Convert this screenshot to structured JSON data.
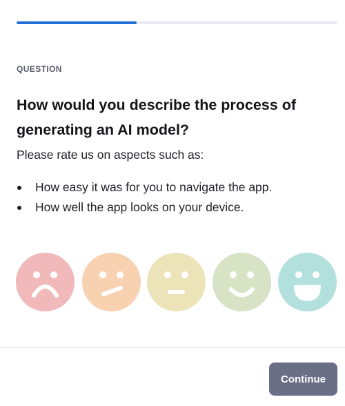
{
  "progress": {
    "fraction": 0.375
  },
  "question": {
    "eyebrow": "QUESTION",
    "title": "How would you describe the process of generating an AI model?",
    "intro": "Please rate us on aspects such as:",
    "bullets": [
      "How easy it was for you to navigate the app.",
      "How well the app looks on your device."
    ]
  },
  "rating": {
    "faces": [
      {
        "icon": "sad-face-icon",
        "color": "#f2b9bb"
      },
      {
        "icon": "skeptical-face-icon",
        "color": "#f7d1b0"
      },
      {
        "icon": "neutral-face-icon",
        "color": "#ece3b8"
      },
      {
        "icon": "smile-face-icon",
        "color": "#d7e3c4"
      },
      {
        "icon": "happy-face-icon",
        "color": "#b2e0dd"
      }
    ]
  },
  "footer": {
    "continue_label": "Continue",
    "button_color": "#6a6f86"
  }
}
